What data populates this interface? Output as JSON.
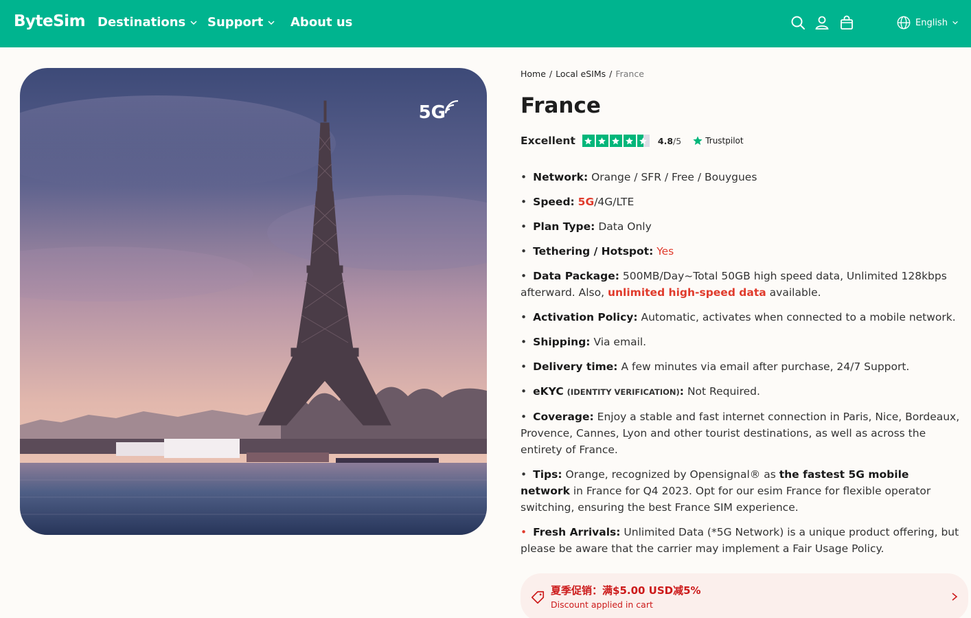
{
  "header": {
    "logo": "ByteSim",
    "nav": [
      {
        "label": "Destinations",
        "dropdown": true
      },
      {
        "label": "Support",
        "dropdown": true
      },
      {
        "label": "About us",
        "dropdown": false
      }
    ],
    "icons": [
      "search-icon",
      "user-icon",
      "cart-icon"
    ],
    "language": "English",
    "bg_color": "#00b48f"
  },
  "hero": {
    "badge": "5G",
    "description_icon": "wifi-signal-icon"
  },
  "breadcrumb": [
    "Home",
    "Local eSIMs",
    "France"
  ],
  "product": {
    "title": "France",
    "rating_label": "Excellent",
    "rating_value": "4.8",
    "rating_max": "/5",
    "rating_stars": 4.5,
    "trustpilot": "Trustpilot"
  },
  "specs": {
    "network_label": "Network:",
    "network_value": "Orange / SFR / Free / Bouygues",
    "speed_label": "Speed:",
    "speed_5g": "5G",
    "speed_rest": "/4G/LTE",
    "plan_label": "Plan Type:",
    "plan_value": "Data Only",
    "tether_label": "Tethering / Hotspot:",
    "tether_value": "Yes",
    "data_label": "Data Package:",
    "data_value": "500MB/Day~Total 50GB high speed data, Unlimited 128kbps afterward. Also,",
    "data_highlight": "unlimited high-speed data",
    "data_tail": "available.",
    "activation_label": "Activation Policy:",
    "activation_value": "Automatic, activates when connected to a mobile network.",
    "shipping_label": "Shipping:",
    "shipping_value": "Via email.",
    "delivery_label": "Delivery time:",
    "delivery_value": "A few minutes via email after purchase, 24/7 Support.",
    "ekyc_label": "eKYC",
    "ekyc_sub": "(IDENTITY VERIFICATION)",
    "ekyc_colon": ":",
    "ekyc_value": "Not Required.",
    "coverage_label": "Coverage:",
    "coverage_value": "Enjoy a stable and fast internet connection in Paris, Nice, Bordeaux, Provence, Cannes, Lyon and other tourist destinations, as well as across the entirety of France.",
    "tips_label": "Tips:",
    "tips_pre": "Orange, recognized by Opensignal® as",
    "tips_bold": "the fastest 5G mobile network",
    "tips_post": "in France for Q4 2023. Opt for our esim France for flexible operator switching, ensuring the best France SIM experience.",
    "fresh_label": "Fresh Arrivals:",
    "fresh_value": "Unlimited Data (*5G Network) is a unique product offering, but please be aware that the carrier may implement a Fair Usage Policy."
  },
  "promo": {
    "title": "夏季促销：满$5.00 USD减5%",
    "subtitle": "Discount applied in cart",
    "color": "#cc1a1a"
  }
}
